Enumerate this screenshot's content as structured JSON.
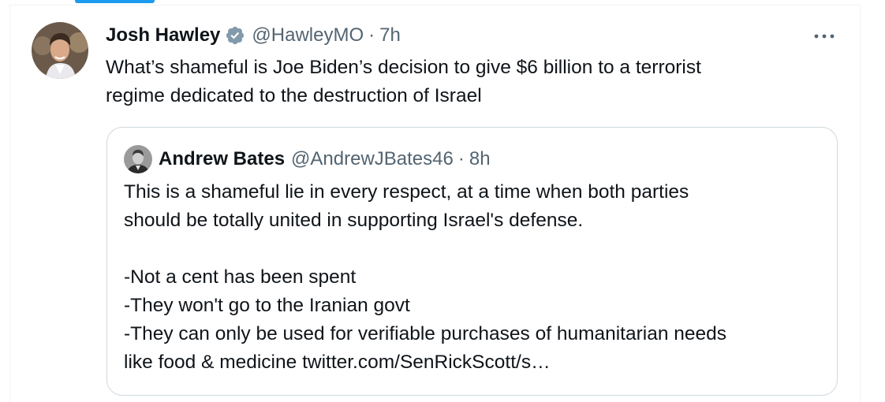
{
  "tweet": {
    "author_name": "Josh Hawley",
    "handle": "@HawleyMO",
    "separator": "·",
    "time": "7h",
    "text": "What’s shameful is Joe Biden’s decision to give $6 billion to a terrorist\nregime dedicated to the destruction of Israel",
    "avatar_icon": "avatar-photo-icon",
    "verified_icon": "verified-badge-icon",
    "verified_color": "#829aab",
    "more_icon": "more-options-icon"
  },
  "quote": {
    "author_name": "Andrew Bates",
    "handle": "@AndrewJBates46",
    "separator": "·",
    "time": "8h",
    "text": "This is a shameful lie in every respect, at a time when both parties\nshould be totally united in supporting Israel's defense.\n\n-Not a cent has been spent\n-They won't go to the Iranian govt\n-They can only be used for verifiable purchases of humanitarian needs\nlike food & medicine twitter.com/SenRickScott/s…",
    "avatar_icon": "avatar-photo-icon"
  },
  "colors": {
    "text_primary": "#0f1419",
    "text_secondary": "#536471",
    "border": "#cfd9de",
    "accent": "#1d9bf0"
  }
}
